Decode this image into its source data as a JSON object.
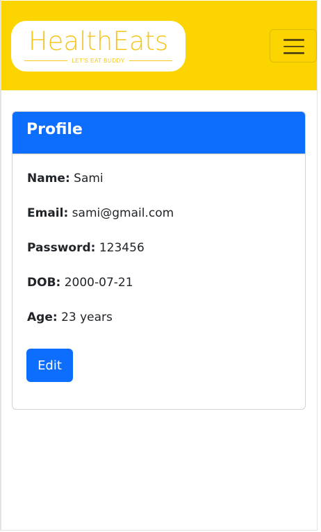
{
  "navbar": {
    "logo_text": "HealthEats",
    "logo_tagline": "LET'S EAT BUDDY",
    "colors": {
      "background": "#fcd501",
      "logo": "#f5c51b"
    }
  },
  "profile": {
    "title": "Profile",
    "fields": [
      {
        "label": "Name:",
        "value": "Sami"
      },
      {
        "label": "Email:",
        "value": "sami@gmail.com"
      },
      {
        "label": "Password:",
        "value": "123456"
      },
      {
        "label": "DOB:",
        "value": "2000-07-21"
      },
      {
        "label": "Age:",
        "value": "23 years"
      }
    ],
    "edit_label": "Edit",
    "colors": {
      "header": "#0d6efd",
      "button": "#0d6efd"
    }
  }
}
